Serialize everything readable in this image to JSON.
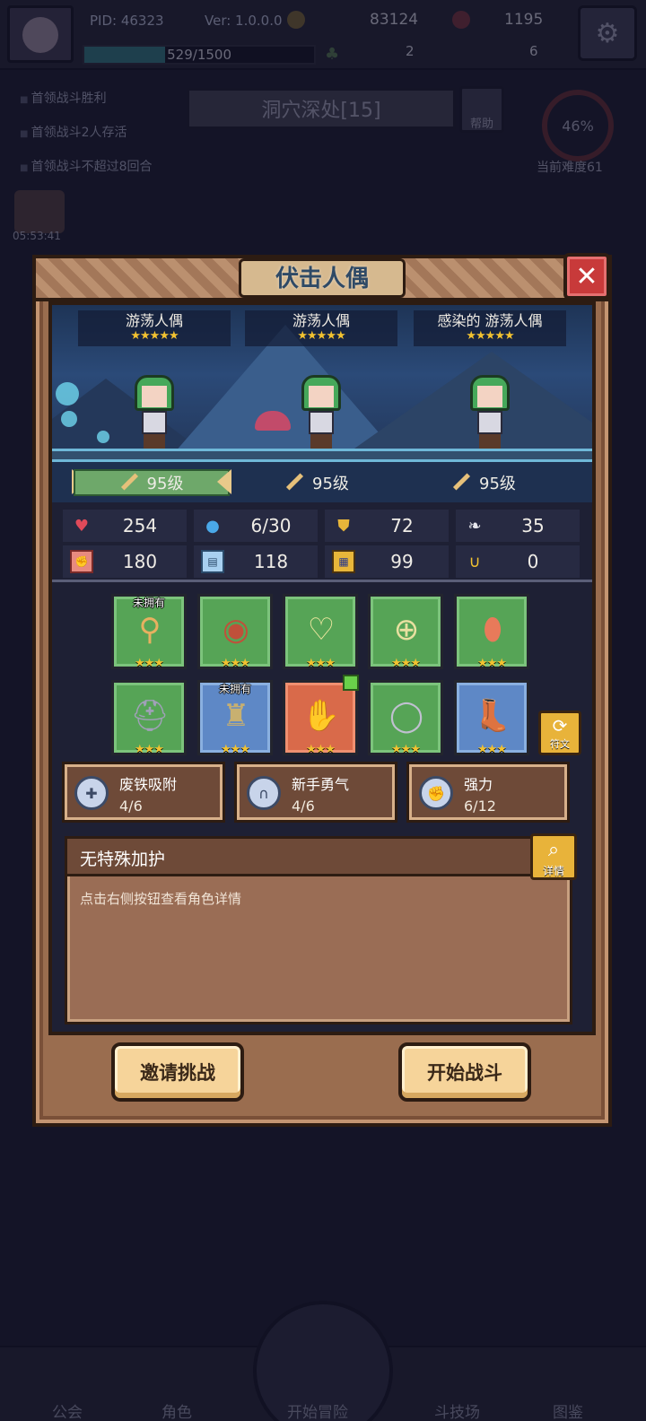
{
  "header": {
    "pid": "PID: 46323",
    "version": "Ver: 1.0.0.0",
    "gold": "83124",
    "gems": "1195",
    "xp": "529/1500",
    "tickets": "2",
    "cards": "6"
  },
  "background": {
    "quests": [
      "首领战斗胜利",
      "首领战斗2人存活",
      "首领战斗不超过8回合"
    ],
    "level_title": "洞穴深处[15]",
    "help_label": "帮助",
    "difficulty_percent": "46%",
    "difficulty_label": "当前难度61",
    "timer": "05:53:41",
    "nav": [
      "公会",
      "角色",
      "开始冒险",
      "斗技场",
      "图鉴"
    ]
  },
  "modal": {
    "title": "伏击人偶",
    "enemies": [
      {
        "name": "游荡人偶",
        "stars": "★★★★★",
        "level": "95级"
      },
      {
        "name": "游荡人偶",
        "stars": "★★★★★",
        "level": "95级"
      },
      {
        "name": "感染的 游荡人偶",
        "stars": "★★★★★",
        "level": "95级"
      }
    ],
    "stats": [
      {
        "icon": "heart-icon",
        "value": "254"
      },
      {
        "icon": "mana-drop-icon",
        "value": "6/30"
      },
      {
        "icon": "shield-icon",
        "value": "72"
      },
      {
        "icon": "wing-icon",
        "value": "35"
      },
      {
        "icon": "fist-icon",
        "value": "180"
      },
      {
        "icon": "book-icon",
        "value": "118"
      },
      {
        "icon": "scroll-icon",
        "value": "99"
      },
      {
        "icon": "horseshoe-icon",
        "value": "0"
      }
    ],
    "equipment": [
      {
        "icon": "staff-icon",
        "tag": "未拥有",
        "stars": "★★★"
      },
      {
        "icon": "round-shield-icon",
        "tag": "",
        "stars": "★★★"
      },
      {
        "icon": "amulet-icon",
        "tag": "",
        "stars": "★★★"
      },
      {
        "icon": "coin-charm-icon",
        "tag": "",
        "stars": "★★★"
      },
      {
        "icon": "egg-icon",
        "tag": "",
        "stars": "★★★"
      },
      {
        "icon": "helmet-icon",
        "tag": "",
        "stars": "★★★"
      },
      {
        "icon": "armor-icon",
        "tag": "未拥有",
        "stars": "★★★"
      },
      {
        "icon": "gauntlet-icon",
        "tag": "",
        "stars": "★★★"
      },
      {
        "icon": "ring-icon",
        "tag": "",
        "stars": "★★★"
      },
      {
        "icon": "boots-icon",
        "tag": "",
        "stars": "★★★"
      }
    ],
    "rune_label": "符文",
    "passives": [
      {
        "name": "废铁吸附",
        "count": "4/6"
      },
      {
        "name": "新手勇气",
        "count": "4/6"
      },
      {
        "name": "强力",
        "count": "6/12"
      }
    ],
    "description_title": "无特殊加护",
    "description_text": "点击右侧按钮查看角色详情",
    "detail_label": "详情",
    "invite_button": "邀请挑战",
    "start_button": "开始战斗"
  }
}
